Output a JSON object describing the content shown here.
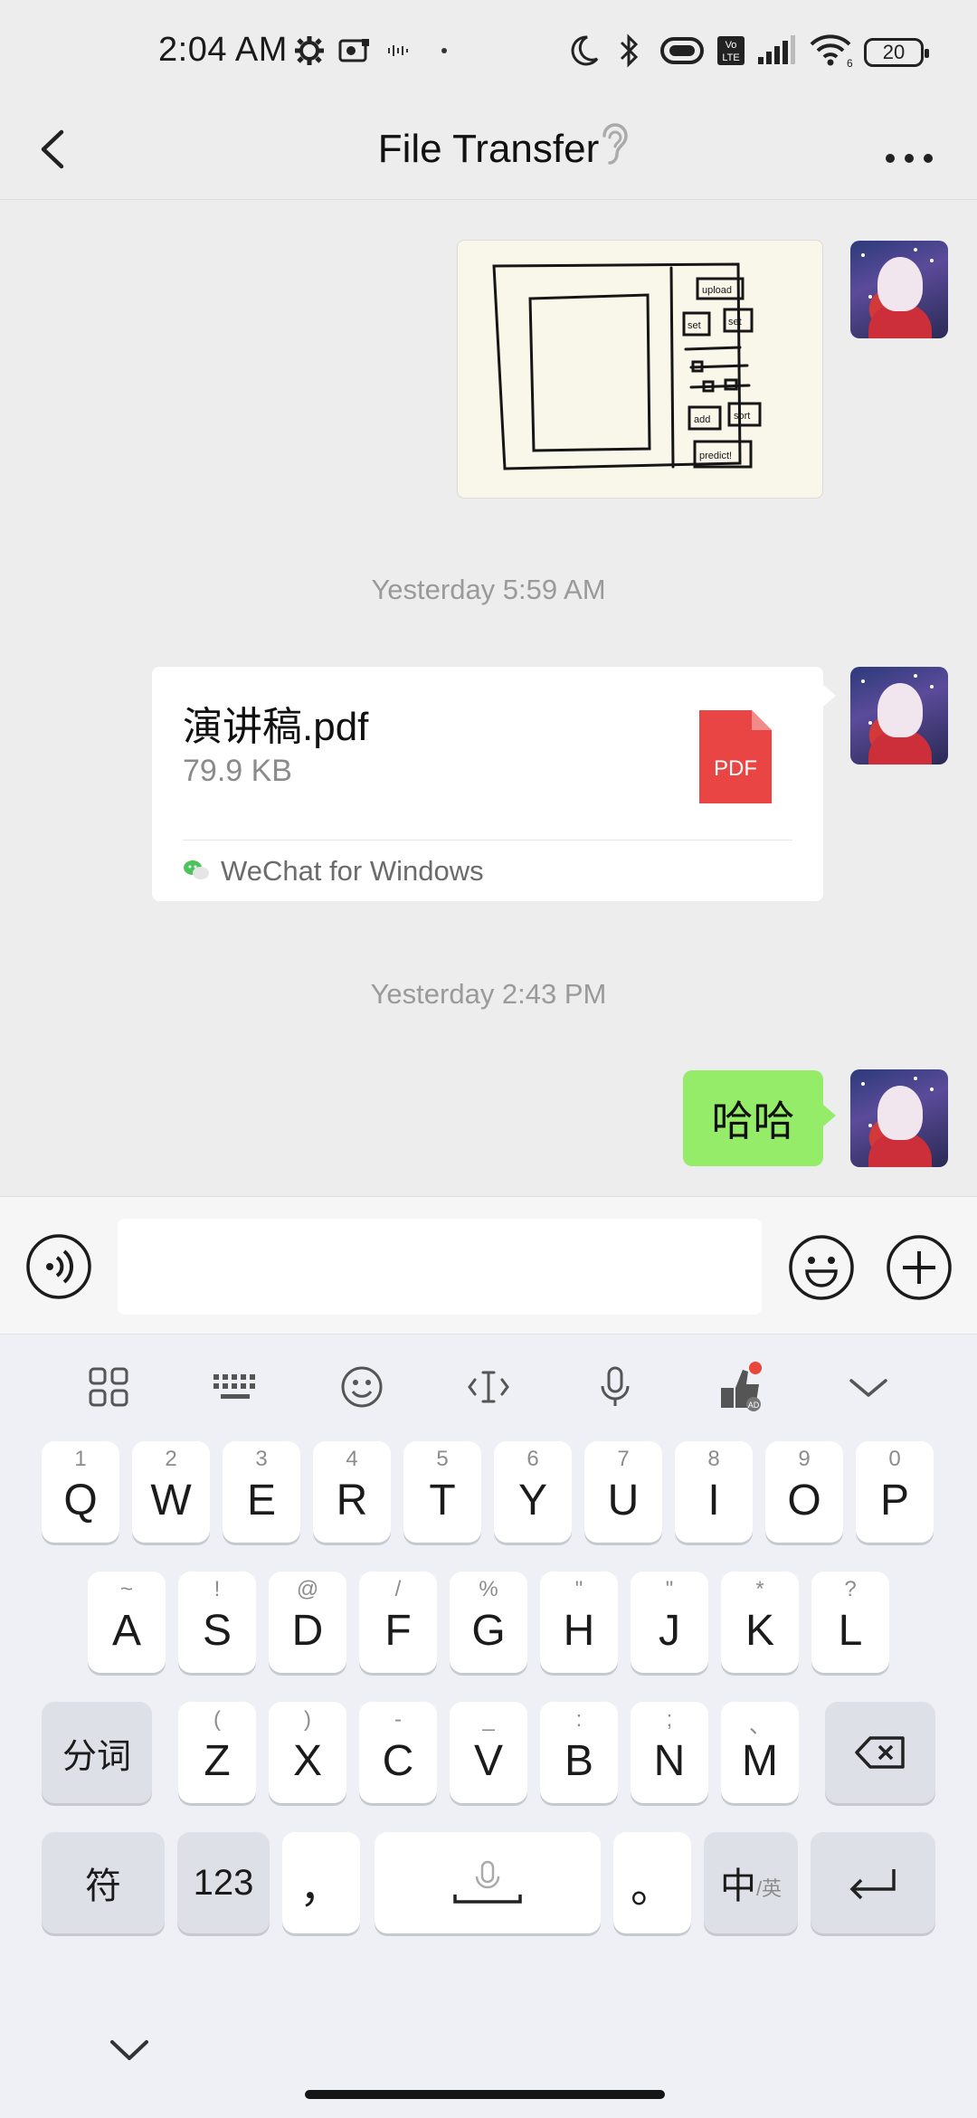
{
  "status_bar": {
    "time": "2:04 AM",
    "battery_level": "20",
    "icons": [
      "gear-icon",
      "photo-icon",
      "voicemail-icon",
      "dot-icon",
      "moon-icon",
      "bluetooth-icon",
      "vibrate-icon",
      "volte-icon",
      "signal-icon",
      "wifi-icon",
      "battery-icon"
    ]
  },
  "header": {
    "title": "File Transfer",
    "back_icon": "chevron-left-icon",
    "ear_icon": "ear-icon",
    "more_icon": "more-dots-icon"
  },
  "messages": {
    "image_message": {
      "type": "image",
      "content": "hand-drawn-ui-sketch",
      "sketch_labels": [
        "upload",
        "set",
        "set",
        "add",
        "sort",
        "predict!"
      ]
    },
    "timestamp_1": "Yesterday 5:59 AM",
    "file_message": {
      "file_name": "演讲稿.pdf",
      "file_size": "79.9 KB",
      "file_type_badge": "PDF",
      "source": "WeChat for Windows"
    },
    "timestamp_2": "Yesterday 2:43 PM",
    "text_message": "哈哈"
  },
  "input_bar": {
    "placeholder": "",
    "voice_icon": "voice-icon",
    "emoji_icon": "emoji-icon",
    "plus_icon": "plus-icon"
  },
  "keyboard": {
    "toolbar": [
      "apps-grid-icon",
      "keyboard-icon",
      "emoji-icon",
      "cursor-icon",
      "mic-icon",
      "ad-icon",
      "chevron-down-icon"
    ],
    "row1": [
      {
        "main": "Q",
        "sub": "1"
      },
      {
        "main": "W",
        "sub": "2"
      },
      {
        "main": "E",
        "sub": "3"
      },
      {
        "main": "R",
        "sub": "4"
      },
      {
        "main": "T",
        "sub": "5"
      },
      {
        "main": "Y",
        "sub": "6"
      },
      {
        "main": "U",
        "sub": "7"
      },
      {
        "main": "I",
        "sub": "8"
      },
      {
        "main": "O",
        "sub": "9"
      },
      {
        "main": "P",
        "sub": "0"
      }
    ],
    "row2": [
      {
        "main": "A",
        "sub": "~"
      },
      {
        "main": "S",
        "sub": "!"
      },
      {
        "main": "D",
        "sub": "@"
      },
      {
        "main": "F",
        "sub": "/"
      },
      {
        "main": "G",
        "sub": "%"
      },
      {
        "main": "H",
        "sub": "\""
      },
      {
        "main": "J",
        "sub": "\""
      },
      {
        "main": "K",
        "sub": "*"
      },
      {
        "main": "L",
        "sub": "?"
      }
    ],
    "row3": [
      {
        "main": "Z",
        "sub": "("
      },
      {
        "main": "X",
        "sub": ")"
      },
      {
        "main": "C",
        "sub": "-"
      },
      {
        "main": "V",
        "sub": "_"
      },
      {
        "main": "B",
        "sub": ":"
      },
      {
        "main": "N",
        "sub": ";"
      },
      {
        "main": "M",
        "sub": "、"
      }
    ],
    "segment_key": "分词",
    "symbol_key": "符",
    "number_key": "123",
    "comma_key": "，",
    "period_key": "。",
    "lang_key_main": "中",
    "lang_key_sub": "/英"
  }
}
